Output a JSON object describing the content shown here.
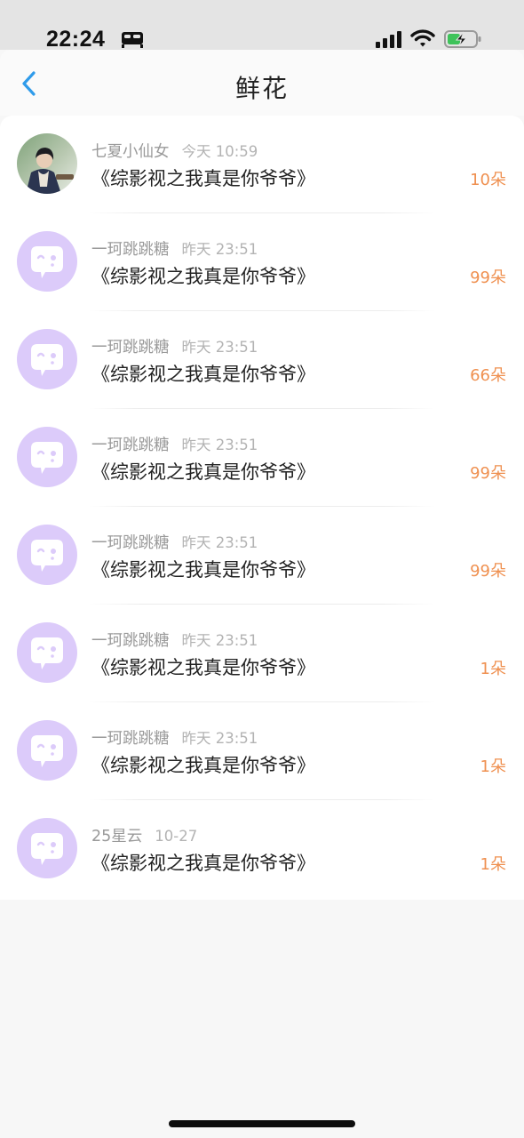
{
  "status_bar": {
    "time": "22:24",
    "icons": [
      "bed-icon",
      "cellular-signal-icon",
      "wifi-icon",
      "battery-charging-icon"
    ]
  },
  "nav": {
    "back_icon": "chevron-left-icon",
    "title": "鲜花"
  },
  "colors": {
    "accent_back": "#2f9bea",
    "count": "#ef9050",
    "default_avatar": "#dccbfa"
  },
  "records": [
    {
      "user": "七夏小仙女",
      "time": "今天 10:59",
      "book": "《综影视之我真是你爷爷》",
      "count": "10朵",
      "avatar": "photo-avatar"
    },
    {
      "user": "一珂跳跳糖",
      "time": "昨天 23:51",
      "book": "《综影视之我真是你爷爷》",
      "count": "99朵",
      "avatar": "default-chat-avatar"
    },
    {
      "user": "一珂跳跳糖",
      "time": "昨天 23:51",
      "book": "《综影视之我真是你爷爷》",
      "count": "66朵",
      "avatar": "default-chat-avatar"
    },
    {
      "user": "一珂跳跳糖",
      "time": "昨天 23:51",
      "book": "《综影视之我真是你爷爷》",
      "count": "99朵",
      "avatar": "default-chat-avatar"
    },
    {
      "user": "一珂跳跳糖",
      "time": "昨天 23:51",
      "book": "《综影视之我真是你爷爷》",
      "count": "99朵",
      "avatar": "default-chat-avatar"
    },
    {
      "user": "一珂跳跳糖",
      "time": "昨天 23:51",
      "book": "《综影视之我真是你爷爷》",
      "count": "1朵",
      "avatar": "default-chat-avatar"
    },
    {
      "user": "一珂跳跳糖",
      "time": "昨天 23:51",
      "book": "《综影视之我真是你爷爷》",
      "count": "1朵",
      "avatar": "default-chat-avatar"
    },
    {
      "user": "25星云",
      "time": "10-27",
      "book": "《综影视之我真是你爷爷》",
      "count": "1朵",
      "avatar": "default-chat-avatar"
    }
  ]
}
